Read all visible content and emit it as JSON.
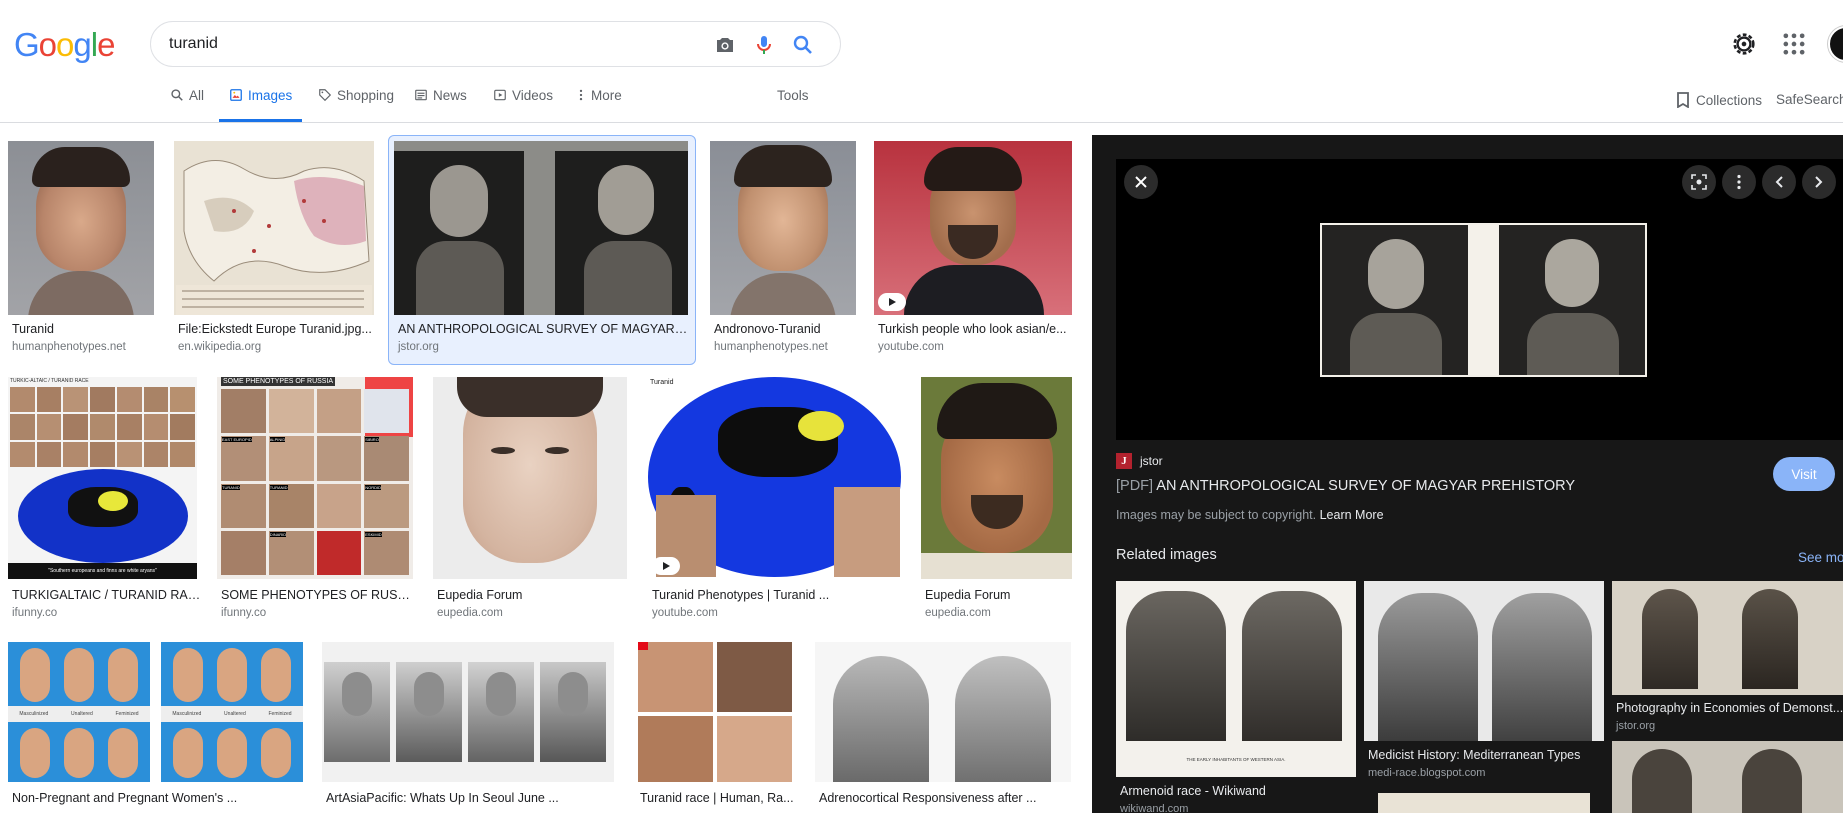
{
  "search": {
    "query": "turanid"
  },
  "nav": {
    "tabs": [
      {
        "label": "All",
        "icon": "search-icon"
      },
      {
        "label": "Images",
        "icon": "image-icon"
      },
      {
        "label": "Shopping",
        "icon": "tag-icon"
      },
      {
        "label": "News",
        "icon": "newspaper-icon"
      },
      {
        "label": "Videos",
        "icon": "play-icon"
      },
      {
        "label": "More",
        "icon": "more-vertical-icon"
      }
    ],
    "tools": "Tools",
    "collections": "Collections",
    "safesearch": "SafeSearch"
  },
  "results": [
    {
      "title": "Turanid",
      "source": "humanphenotypes.net"
    },
    {
      "title": "File:Eickstedt Europe Turanid.jpg...",
      "source": "en.wikipedia.org"
    },
    {
      "title": "AN ANTHROPOLOGICAL SURVEY OF MAGYAR ...",
      "source": "jstor.org"
    },
    {
      "title": "Andronovo-Turanid",
      "source": "humanphenotypes.net"
    },
    {
      "title": "Turkish people who look asian/e...",
      "source": "youtube.com"
    },
    {
      "title": "TURKIGALTAIC / TURANID RAC...",
      "source": "ifunny.co"
    },
    {
      "title": "SOME PHENOTYPES OF RUSSIA...",
      "source": "ifunny.co"
    },
    {
      "title": "Eupedia Forum",
      "source": "eupedia.com"
    },
    {
      "title": "Turanid Phenotypes | Turanid ...",
      "source": "youtube.com"
    },
    {
      "title": "Eupedia Forum",
      "source": "eupedia.com"
    },
    {
      "title": "Non-Pregnant and Pregnant Women's ...",
      "source": ""
    },
    {
      "title": "ArtAsiaPacific: Whats Up In Seoul June ...",
      "source": ""
    },
    {
      "title": "Turanid race | Human, Ra...",
      "source": ""
    },
    {
      "title": "Adrenocortical Responsiveness after ...",
      "source": ""
    }
  ],
  "thumb_text": {
    "turkic_header": "TURKIC-ALTAIC / TURANID RACE",
    "turkic_caption": "\"Southern europeans and finns are white aryans\"",
    "russia_header": "SOME PHENOTYPES OF RUSSIA",
    "russia_labels": [
      "EAST EUROPID",
      "ALPINID",
      "SIBIRO",
      "TURANID",
      "TURANID",
      "NORDID",
      "DINARID",
      "ESKIMID"
    ],
    "turanid_map_label": "Turanid",
    "pregnancy_labels": [
      "Masculinized",
      "Unaltered",
      "Feminized"
    ]
  },
  "panel": {
    "source_name": "jstor",
    "source_logo": "J",
    "pdf_tag": "[PDF]",
    "title": "AN ANTHROPOLOGICAL SURVEY OF MAGYAR PREHISTORY",
    "copyright": "Images may be subject to copyright.",
    "learn_more": "Learn More",
    "visit": "Visit",
    "related_heading": "Related images",
    "see_more": "See more",
    "related": [
      {
        "title": "Armenoid race - Wikiwand",
        "source": "wikiwand.com",
        "caption": "THE EARLY INHABITANTS OF WESTERN ASIA."
      },
      {
        "title": "Medicist History: Mediterranean Types",
        "source": "medi-race.blogspot.com"
      },
      {
        "title": "Photography in Economies of Demonst...",
        "source": "jstor.org"
      }
    ]
  },
  "colors": {
    "accent": "#1a73e8",
    "panel_bg": "#171717",
    "visit_button": "#8ab4f8"
  }
}
